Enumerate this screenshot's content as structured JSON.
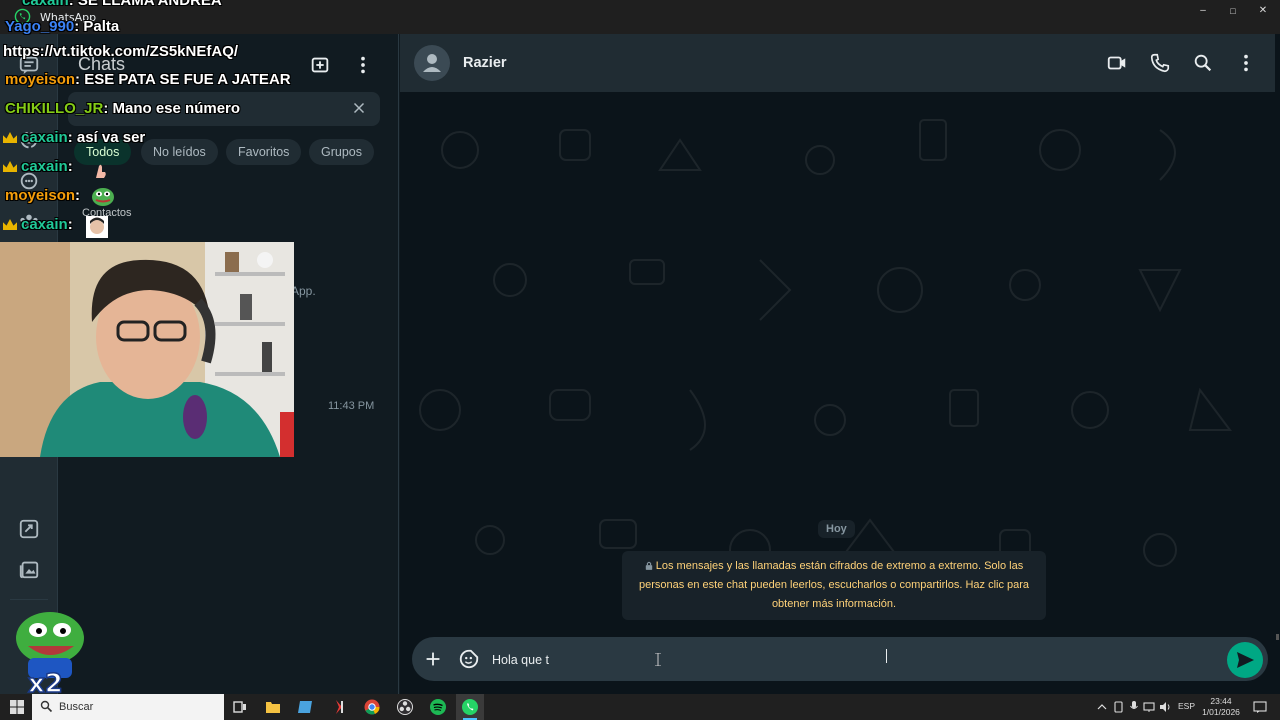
{
  "window": {
    "app_title": "WhatsApp",
    "controls": [
      "–",
      "□",
      "✕"
    ]
  },
  "chat_list": {
    "title": "Chats",
    "filters": [
      "Todos",
      "No leídos",
      "Favoritos",
      "Grupos"
    ],
    "active_filter": "Todos",
    "contacts_label": "Contactos",
    "app_fragment": "App.",
    "chat_time": "11:43 PM"
  },
  "stream_overlay": {
    "messages": [
      {
        "user": "caxain",
        "text": ": SE LLAMA ANDREA",
        "color": "#20c997",
        "crown": false
      },
      {
        "user": "Yago_990",
        "text": ": Palta",
        "color": "#3b82f6",
        "crown": false
      },
      {
        "user": "",
        "text": "https://vt.tiktok.com/ZS5kNEfAQ/",
        "color": "#ffffff",
        "crown": false
      },
      {
        "user": "moyeison",
        "text": ": ESE PATA SE FUE A JATEAR",
        "color": "#f59e0b",
        "crown": false
      },
      {
        "user": "CHIKILLO_JR",
        "text": ": Mano ese número",
        "color": "#84cc16",
        "crown": false
      },
      {
        "user": "caxain",
        "text": ": así va ser",
        "color": "#20c997",
        "crown": true
      },
      {
        "user": "caxain",
        "text": ":",
        "color": "#20c997",
        "crown": true
      },
      {
        "user": "moyeison",
        "text": ":",
        "color": "#f59e0b",
        "crown": false
      },
      {
        "user": "caxain",
        "text": ":",
        "color": "#20c997",
        "crown": true
      }
    ],
    "sticker_label": "x2"
  },
  "conversation": {
    "contact_name": "Razier",
    "day_label": "Hoy",
    "encryption_notice": "Los mensajes y las llamadas están cifrados de extremo a extremo. Solo las personas en este chat pueden leerlos, escucharlos o compartirlos. Haz clic para obtener más información.",
    "composer_value": "Hola que t"
  },
  "taskbar": {
    "search_label": "Buscar",
    "language": "ESP",
    "time": "23:44",
    "date": "1/01/2026"
  },
  "colors": {
    "accent": "#00a884",
    "panel": "#202c33",
    "background": "#111b21",
    "notice_text": "#ffd279"
  }
}
